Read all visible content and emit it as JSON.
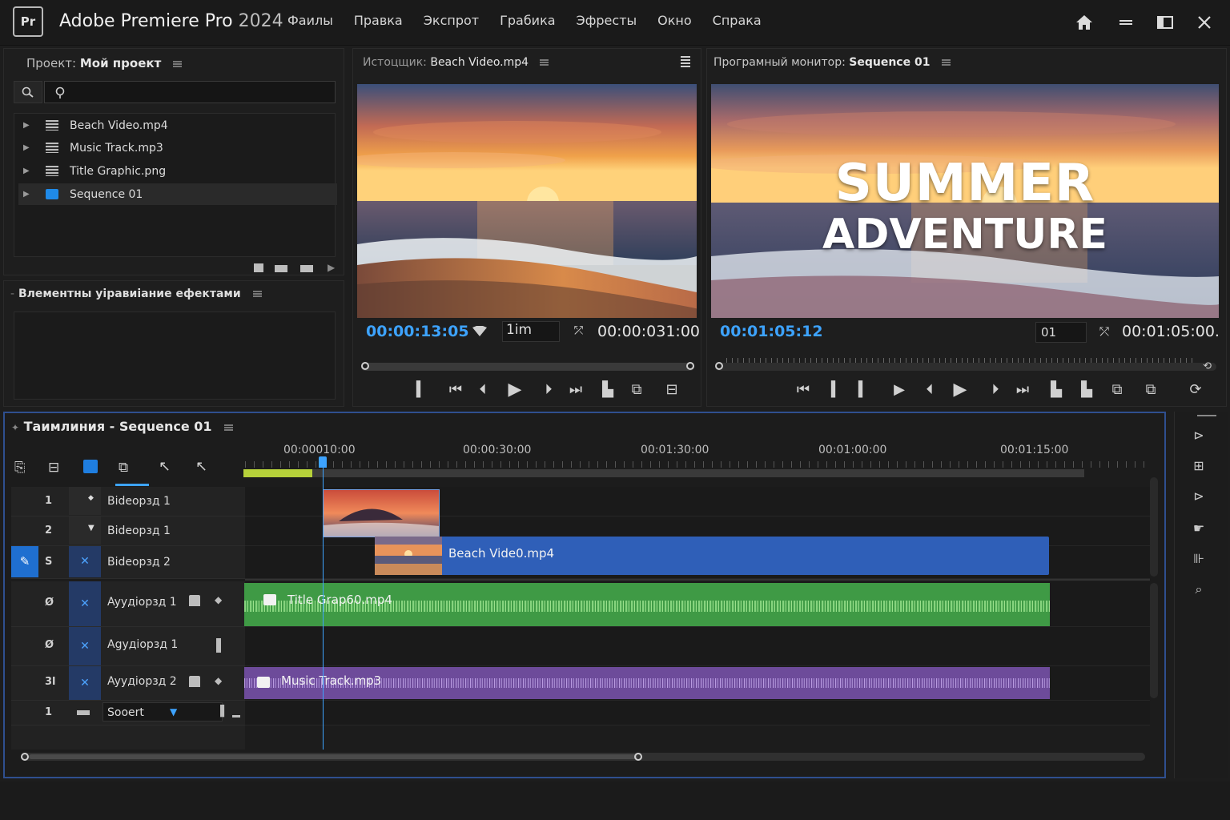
{
  "app": {
    "name": "Adobe Premiere Pro",
    "year": "2024",
    "logo_text": "Pr"
  },
  "menu": [
    "Фаилы",
    "Правка",
    "Экспрот",
    "Грабика",
    "Эфресты",
    "Окно",
    "Спрака"
  ],
  "project_panel": {
    "label": "Проект:",
    "name": "Мой проект",
    "search_value": "",
    "items": [
      {
        "name": "Beach Video.mp4",
        "type": "video"
      },
      {
        "name": "Music Track.mp3",
        "type": "audio"
      },
      {
        "name": "Title Graphic.png",
        "type": "image"
      },
      {
        "name": "Sequence 01",
        "type": "sequence"
      }
    ]
  },
  "effects_panel": {
    "title": "Влементны уіравиіание ефектами"
  },
  "source_monitor": {
    "label": "Истоцщик:",
    "clip": "Beach Video.mp4",
    "current_tc": "00:00:13:05",
    "zoom": "1im",
    "duration_tc": "00:00:031:00",
    "playhead_fraction": 0.0
  },
  "program_monitor": {
    "label": "Програмный монитор:",
    "sequence": "Sequence 01",
    "title_line1": "SUMMER",
    "title_line2": "ADVENTURE",
    "current_tc": "00:01:05:12",
    "zoom": "01",
    "duration_tc": "00:01:05:00.",
    "playhead_fraction": 0.0
  },
  "timeline": {
    "label": "Таимлиния -",
    "sequence": "Sequence 01",
    "ruler": [
      "00:00010:00",
      "00:00:30:00",
      "00:01:30:00",
      "00:01:00:00",
      "00:01:15:00"
    ],
    "tracks": [
      {
        "num": "1",
        "name": "Bideорзд 1"
      },
      {
        "num": "2",
        "name": "Bideорзд 1"
      },
      {
        "num": "S",
        "name": "Bideорзд 2"
      },
      {
        "num": "Ø",
        "name": "Ayyдiорзд 1"
      },
      {
        "num": "Ø",
        "name": "Agyдiорзд 1"
      },
      {
        "num": "3l",
        "name": "Ayyдiорзд 2"
      },
      {
        "num": "1",
        "name": "Sooert"
      }
    ],
    "clips": {
      "video": "Beach Vide0.mp4",
      "title": "Title Grap60.mp4",
      "music": "Music Track.mp3"
    }
  },
  "colors": {
    "accent": "#3da3ff",
    "video_clip": "#2f5fb8",
    "audio_clip_green": "#3f9a45",
    "audio_clip_purple": "#6d4b9a",
    "timeline_border": "#2f4f8f"
  }
}
